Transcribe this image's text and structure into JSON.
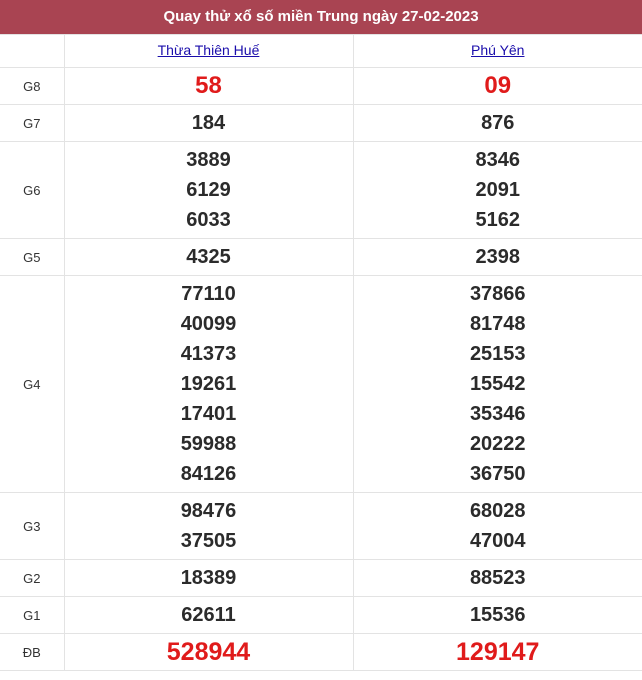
{
  "title": "Quay thử xổ số miền Trung ngày 27-02-2023",
  "provinces": [
    "Thừa Thiên Huế",
    "Phú Yên"
  ],
  "colors": {
    "header_bg": "#a94452",
    "highlight": "#e01b1b",
    "link": "#1a0dab"
  },
  "rows": [
    {
      "label": "G8",
      "red": true,
      "cols": [
        [
          "58"
        ],
        [
          "09"
        ]
      ]
    },
    {
      "label": "G7",
      "red": false,
      "cols": [
        [
          "184"
        ],
        [
          "876"
        ]
      ]
    },
    {
      "label": "G6",
      "red": false,
      "cols": [
        [
          "3889",
          "6129",
          "6033"
        ],
        [
          "8346",
          "2091",
          "5162"
        ]
      ]
    },
    {
      "label": "G5",
      "red": false,
      "cols": [
        [
          "4325"
        ],
        [
          "2398"
        ]
      ]
    },
    {
      "label": "G4",
      "red": false,
      "cols": [
        [
          "77110",
          "40099",
          "41373",
          "19261",
          "17401",
          "59988",
          "84126"
        ],
        [
          "37866",
          "81748",
          "25153",
          "15542",
          "35346",
          "20222",
          "36750"
        ]
      ]
    },
    {
      "label": "G3",
      "red": false,
      "cols": [
        [
          "98476",
          "37505"
        ],
        [
          "68028",
          "47004"
        ]
      ]
    },
    {
      "label": "G2",
      "red": false,
      "cols": [
        [
          "18389"
        ],
        [
          "88523"
        ]
      ]
    },
    {
      "label": "G1",
      "red": false,
      "cols": [
        [
          "62611"
        ],
        [
          "15536"
        ]
      ]
    },
    {
      "label": "ĐB",
      "red": true,
      "cols": [
        [
          "528944"
        ],
        [
          "129147"
        ]
      ]
    }
  ]
}
